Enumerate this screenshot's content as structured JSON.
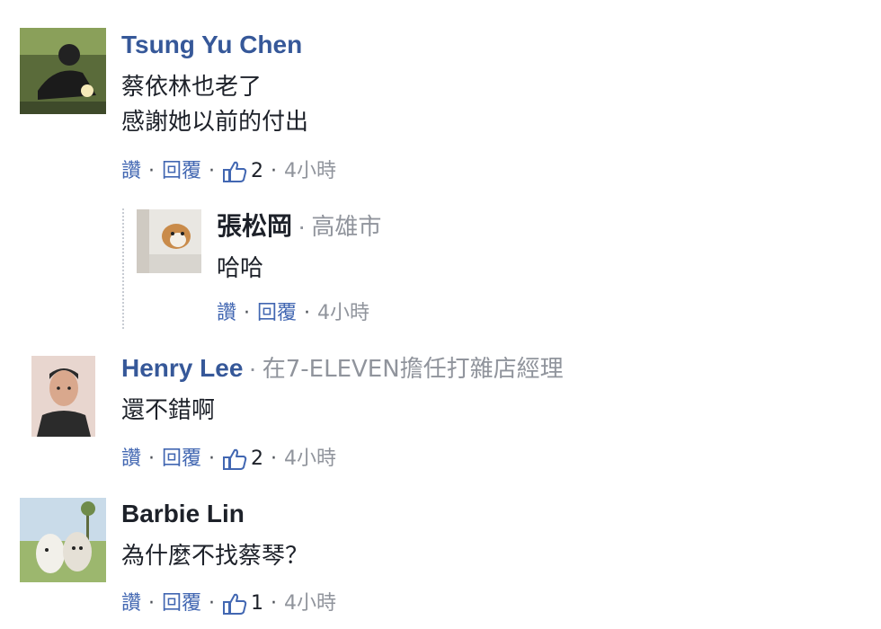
{
  "comments": [
    {
      "author": "Tsung Yu Chen",
      "lines": [
        "蔡依林也老了",
        "感謝她以前的付出"
      ],
      "like_label": "讚",
      "reply_label": "回覆",
      "like_count": "2",
      "time": "4小時"
    },
    {
      "author": "張松岡",
      "location": "高雄市",
      "lines": [
        "哈哈"
      ],
      "like_label": "讚",
      "reply_label": "回覆",
      "time": "4小時"
    },
    {
      "author": "Henry Lee",
      "location": "在7-ELEVEN擔任打雜店經理",
      "lines": [
        "還不錯啊"
      ],
      "like_label": "讚",
      "reply_label": "回覆",
      "like_count": "2",
      "time": "4小時"
    },
    {
      "author": "Barbie Lin",
      "lines": [
        "為什麼不找蔡琴？"
      ],
      "like_label": "讚",
      "reply_label": "回覆",
      "like_count": "1",
      "time": "4小時"
    }
  ],
  "icons": {
    "like": "thumbs-up-icon"
  },
  "colors": {
    "link": "#4267b2",
    "author": "#365899",
    "muted": "#90949c",
    "text": "#1d2129"
  }
}
